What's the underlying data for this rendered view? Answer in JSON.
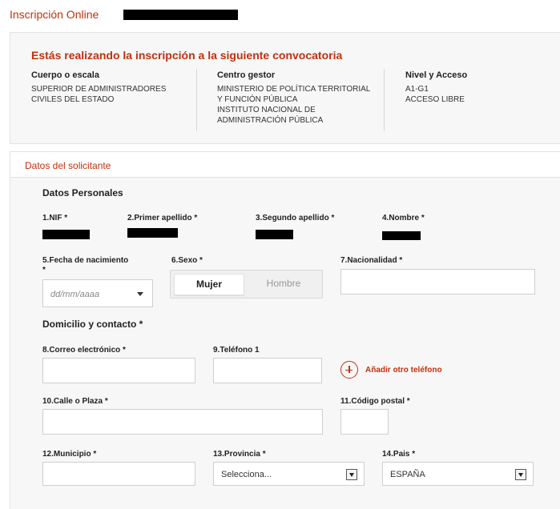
{
  "page": {
    "title": "Inscripción Online"
  },
  "convocatoria": {
    "heading": "Estás realizando la inscripción a la siguiente convocatoria",
    "cuerpo": {
      "label": "Cuerpo o escala",
      "lines": [
        "SUPERIOR DE ADMINISTRADORES",
        "CIVILES DEL ESTADO"
      ]
    },
    "centro": {
      "label": "Centro gestor",
      "lines": [
        "MINISTERIO DE POLÍTICA TERRITORIAL",
        "Y FUNCIÓN PÚBLICA",
        "INSTITUTO NACIONAL DE",
        "ADMINISTRACIÓN PÚBLICA"
      ]
    },
    "nivel": {
      "label": "Nivel y Acceso",
      "lines": [
        "A1-G1",
        "ACCESO LIBRE"
      ]
    }
  },
  "solicitante": {
    "title": "Datos del solicitante",
    "personales": {
      "title": "Datos Personales",
      "nif_label": "1.NIF *",
      "apellido1_label": "2.Primer apellido *",
      "apellido2_label": "3.Segundo apellido *",
      "nombre_label": "4.Nombre *",
      "fecha_label_1": "5.Fecha de nacimiento",
      "fecha_label_2": "*",
      "fecha_placeholder": "dd/mm/aaaa",
      "sexo_label": "6.Sexo *",
      "sexo_options": [
        "Mujer",
        "Hombre"
      ],
      "sexo_selected": "Mujer",
      "nacionalidad_label": "7.Nacionalidad *"
    },
    "domicilio": {
      "title": "Domicilio y contacto *",
      "correo_label": "8.Correo electrónico *",
      "telefono_label": "9.Teléfono 1",
      "add_phone_label": "Añadir otro teléfono",
      "calle_label": "10.Calle o Plaza *",
      "cp_label": "11.Código postal *",
      "municipio_label": "12.Municipio *",
      "provincia_label": "13.Provincia *",
      "provincia_value": "Selecciona...",
      "pais_label": "14.Pais *",
      "pais_value": "ESPAÑA"
    }
  },
  "colors": {
    "accent": "#c4300c",
    "panel_bg": "#f7f7f7",
    "border": "#e2e2e2"
  },
  "icons": {
    "add_phone": "plus-circle-icon",
    "select_arrow": "chevron-down-icon",
    "date_arrow": "caret-down-icon"
  }
}
